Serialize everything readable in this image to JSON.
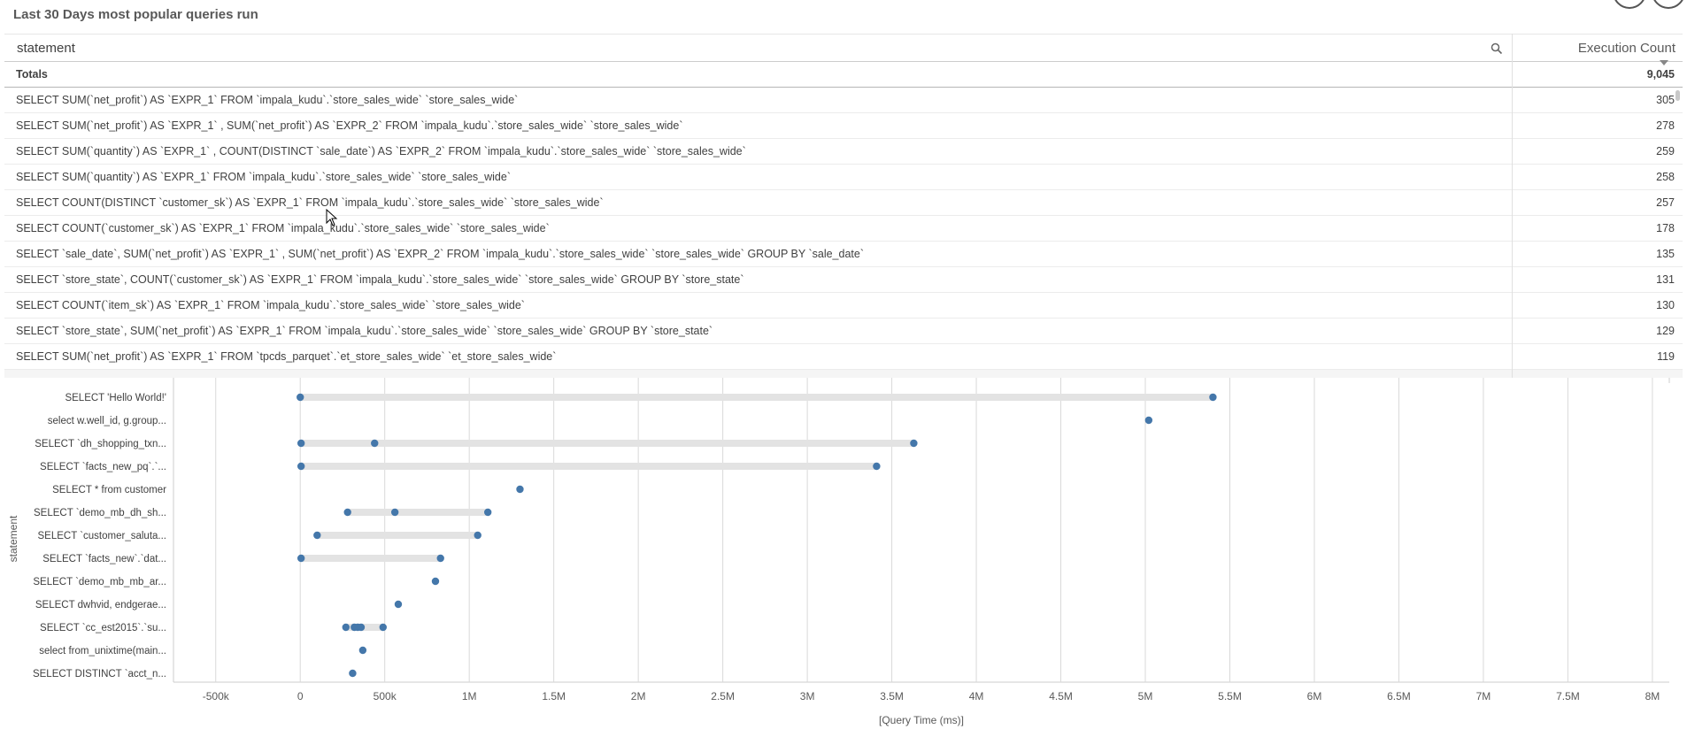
{
  "title": "Last 30 Days most popular queries run",
  "table": {
    "col_statement": "statement",
    "col_count": "Execution Count",
    "totals_label": "Totals",
    "totals_value": "9,045",
    "rows": [
      {
        "statement": "SELECT SUM(`net_profit`) AS `EXPR_1` FROM `impala_kudu`.`store_sales_wide` `store_sales_wide`",
        "count": "305"
      },
      {
        "statement": "SELECT SUM(`net_profit`) AS `EXPR_1` , SUM(`net_profit`) AS `EXPR_2` FROM `impala_kudu`.`store_sales_wide` `store_sales_wide`",
        "count": "278"
      },
      {
        "statement": "SELECT SUM(`quantity`) AS `EXPR_1` , COUNT(DISTINCT `sale_date`) AS `EXPR_2` FROM `impala_kudu`.`store_sales_wide` `store_sales_wide`",
        "count": "259"
      },
      {
        "statement": "SELECT SUM(`quantity`) AS `EXPR_1` FROM `impala_kudu`.`store_sales_wide` `store_sales_wide`",
        "count": "258"
      },
      {
        "statement": "SELECT COUNT(DISTINCT `customer_sk`) AS `EXPR_1` FROM `impala_kudu`.`store_sales_wide` `store_sales_wide`",
        "count": "257"
      },
      {
        "statement": "SELECT COUNT(`customer_sk`) AS `EXPR_1` FROM `impala_kudu`.`store_sales_wide` `store_sales_wide`",
        "count": "178"
      },
      {
        "statement": "SELECT `sale_date`, SUM(`net_profit`) AS `EXPR_1` , SUM(`net_profit`) AS `EXPR_2` FROM `impala_kudu`.`store_sales_wide` `store_sales_wide` GROUP BY `sale_date`",
        "count": "135"
      },
      {
        "statement": "SELECT `store_state`, COUNT(`customer_sk`) AS `EXPR_1` FROM `impala_kudu`.`store_sales_wide` `store_sales_wide` GROUP BY `store_state`",
        "count": "131"
      },
      {
        "statement": "SELECT COUNT(`item_sk`) AS `EXPR_1` FROM `impala_kudu`.`store_sales_wide` `store_sales_wide`",
        "count": "130"
      },
      {
        "statement": "SELECT `store_state`, SUM(`net_profit`) AS `EXPR_1` FROM `impala_kudu`.`store_sales_wide` `store_sales_wide` GROUP BY `store_state`",
        "count": "129"
      },
      {
        "statement": "SELECT SUM(`net_profit`) AS `EXPR_1` FROM `tpcds_parquet`.`et_store_sales_wide` `et_store_sales_wide`",
        "count": "119"
      }
    ]
  },
  "icons": {
    "search": "search-icon",
    "sort": "sort-descending-icon"
  },
  "colors": {
    "dot": "#4477aa",
    "range_bar": "#e3e3e3",
    "grid": "#d9d9d9"
  },
  "chart_data": {
    "type": "scatter",
    "xlabel": "[Query Time (ms)]",
    "ylabel": "statement",
    "xlim": [
      -750000,
      8100000
    ],
    "x_ticks": [
      -500000,
      0,
      500000,
      1000000,
      1500000,
      2000000,
      2500000,
      3000000,
      3500000,
      4000000,
      4500000,
      5000000,
      5500000,
      6000000,
      6500000,
      7000000,
      7500000,
      8000000
    ],
    "x_tick_labels": [
      "-500k",
      "0",
      "500k",
      "1M",
      "1.5M",
      "2M",
      "2.5M",
      "3M",
      "3.5M",
      "4M",
      "4.5M",
      "5M",
      "5.5M",
      "6M",
      "6.5M",
      "7M",
      "7.5M",
      "8M"
    ],
    "grid": true,
    "categories": [
      "SELECT 'Hello World!'",
      "select w.well_id,    g.group...",
      "SELECT `dh_shopping_txn...",
      "SELECT `facts_new_pq`.`...",
      "SELECT * from customer",
      "SELECT `demo_mb_dh_sh...",
      "SELECT `customer_saluta...",
      "SELECT `facts_new`.`dat...",
      "SELECT `demo_mb_mb_ar...",
      "SELECT  dwhvid, endgerae...",
      "SELECT `cc_est2015`.`su...",
      "select from_unixtime(main...",
      "SELECT DISTINCT `acct_n..."
    ],
    "points": [
      [
        0,
        5400000
      ],
      [
        5020000
      ],
      [
        5000,
        440000,
        3630000
      ],
      [
        5000,
        3410000
      ],
      [
        1300000
      ],
      [
        280000,
        560000,
        1110000
      ],
      [
        100000,
        1050000
      ],
      [
        5000,
        830000
      ],
      [
        800000
      ],
      [
        580000
      ],
      [
        270000,
        320000,
        340000,
        360000,
        490000
      ],
      [
        370000
      ],
      [
        310000
      ]
    ]
  }
}
